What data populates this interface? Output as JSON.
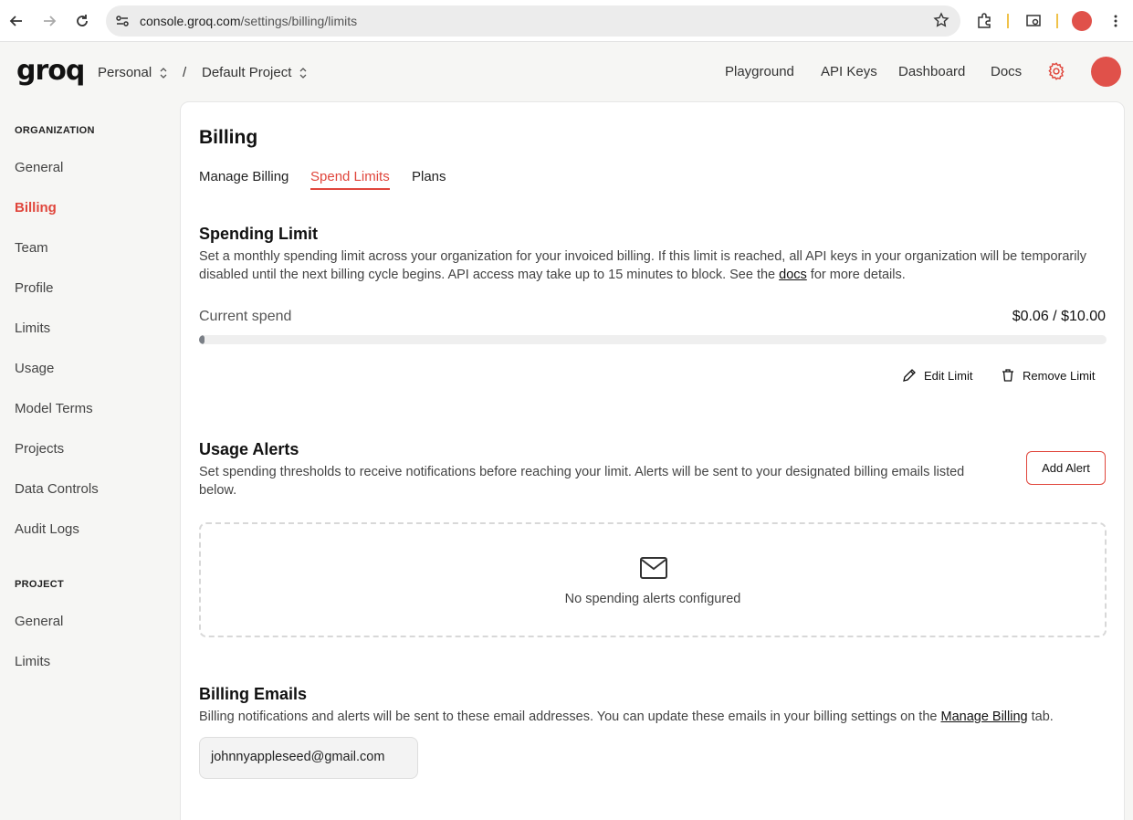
{
  "browser": {
    "url_host": "console.groq.com",
    "url_path": "/settings/billing/limits"
  },
  "header": {
    "logo": "groq",
    "org": "Personal",
    "separator": "/",
    "project": "Default Project",
    "nav": [
      "Playground",
      "API Keys",
      "Dashboard",
      "Docs"
    ]
  },
  "sidebar": {
    "org_heading": "ORGANIZATION",
    "org_items": [
      "General",
      "Billing",
      "Team",
      "Profile",
      "Limits",
      "Usage",
      "Model Terms",
      "Projects",
      "Data Controls",
      "Audit Logs"
    ],
    "active_item": "Billing",
    "project_heading": "PROJECT",
    "project_items": [
      "General",
      "Limits"
    ]
  },
  "main": {
    "title": "Billing",
    "tabs": [
      "Manage Billing",
      "Spend Limits",
      "Plans"
    ],
    "active_tab": "Spend Limits",
    "spending": {
      "title": "Spending Limit",
      "desc_before": "Set a monthly spending limit across your organization for your invoiced billing. If this limit is reached, all API keys in your organization will be temporarily disabled until the next billing cycle begins. API access may take up to 15 minutes to block. See the ",
      "desc_link": "docs",
      "desc_after": " for more details.",
      "current_label": "Current spend",
      "current_value": "$0.06 / $10.00",
      "progress_fraction": 0.006,
      "edit_label": "Edit Limit",
      "remove_label": "Remove Limit"
    },
    "alerts": {
      "title": "Usage Alerts",
      "desc": "Set spending thresholds to receive notifications before reaching your limit. Alerts will be sent to your designated billing emails listed below.",
      "add_label": "Add Alert",
      "empty_text": "No spending alerts configured"
    },
    "emails": {
      "title": "Billing Emails",
      "desc_before": "Billing notifications and alerts will be sent to these email addresses. You can update these emails in your billing settings on the ",
      "desc_link": "Manage Billing",
      "desc_after": " tab.",
      "email": "johnnyappleseed@gmail.com"
    }
  },
  "colors": {
    "accent": "#e0463c",
    "avatar": "#e0514a"
  }
}
